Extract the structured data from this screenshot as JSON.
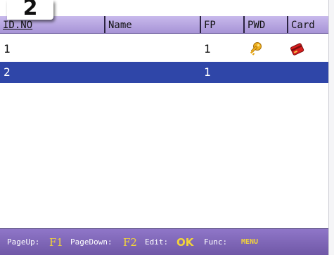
{
  "step_badge": {
    "number": "2"
  },
  "table": {
    "columns": {
      "id": "ID.NO",
      "name": "Name",
      "fp": "FP",
      "pwd": "PWD",
      "card": "Card"
    },
    "rows": [
      {
        "id": "1",
        "name": "",
        "fp": "1",
        "pwd_icon": "key-icon",
        "card_icon": "card-icon",
        "selected": false
      },
      {
        "id": "2",
        "name": "",
        "fp": "1",
        "pwd_icon": "",
        "card_icon": "",
        "selected": true
      }
    ]
  },
  "footer": {
    "pageup_label": "PageUp:",
    "pageup_key": "F1",
    "pagedown_label": "PageDown:",
    "pagedown_key": "F2",
    "edit_label": "Edit:",
    "edit_key": "OK",
    "func_label": "Func:",
    "func_key": "MENU"
  },
  "colors": {
    "header": "#b7a7e3",
    "selected_row": "#2f46a8",
    "footer": "#7d64b7",
    "key_highlight": "#f2d43a"
  }
}
